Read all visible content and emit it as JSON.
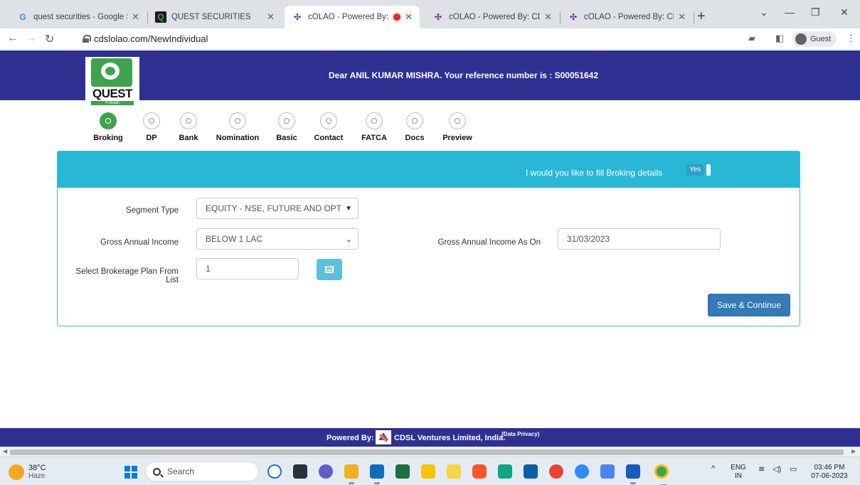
{
  "browser": {
    "tabs": [
      {
        "title": "quest securities - Google Sea",
        "icon": "google-icon"
      },
      {
        "title": "QUEST SECURITIES",
        "icon": "quest-icon"
      },
      {
        "title": "cOLAO - Powered By: CD",
        "icon": "cdsl-icon",
        "active": true,
        "recording": true
      },
      {
        "title": "cOLAO - Powered By: CDSL V",
        "icon": "cdsl-icon"
      },
      {
        "title": "cOLAO - Powered By: CDSL V",
        "icon": "cdsl-icon"
      }
    ],
    "url": "cdslolao.com/NewIndividual",
    "profile_label": "Guest"
  },
  "header": {
    "logo_text": "QUEST",
    "logo_sub": "4 Wealth",
    "message": "Dear ANIL KUMAR MISHRA. Your reference number is : S00051642"
  },
  "steps": [
    {
      "label": "Broking",
      "active": true
    },
    {
      "label": "DP"
    },
    {
      "label": "Bank"
    },
    {
      "label": "Nomination"
    },
    {
      "label": "Basic"
    },
    {
      "label": "Contact"
    },
    {
      "label": "FATCA"
    },
    {
      "label": "Docs"
    },
    {
      "label": "Preview"
    }
  ],
  "panel": {
    "question": "I would you like to fill Broking details",
    "toggle_label": "Yes"
  },
  "form": {
    "segment_type_label": "Segment Type",
    "segment_type_value": "EQUITY - NSE, FUTURE AND OPT",
    "income_label": "Gross Annual Income",
    "income_value": "BELOW 1 LAC",
    "income_on_label": "Gross Annual Income As On",
    "income_on_value": "31/03/2023",
    "brokerage_label_1": "Select Brokerage Plan From",
    "brokerage_label_2": "List",
    "brokerage_value": "1",
    "save_label": "Save & Continue"
  },
  "footer": {
    "powered_by": "Powered By:",
    "company": "CDSL Ventures Limited, India.",
    "privacy": "(Data Privacy)"
  },
  "taskbar": {
    "temperature": "38°C",
    "weather": "Haze",
    "search_placeholder": "Search",
    "lang_1": "ENG",
    "lang_2": "IN",
    "time": "03:46 PM",
    "date": "07-06-2023"
  },
  "colors": {
    "header_bg": "#2e3192",
    "panel_head": "#29b7d6",
    "save_button": "#337ab7",
    "step_active": "#3fa34d"
  }
}
